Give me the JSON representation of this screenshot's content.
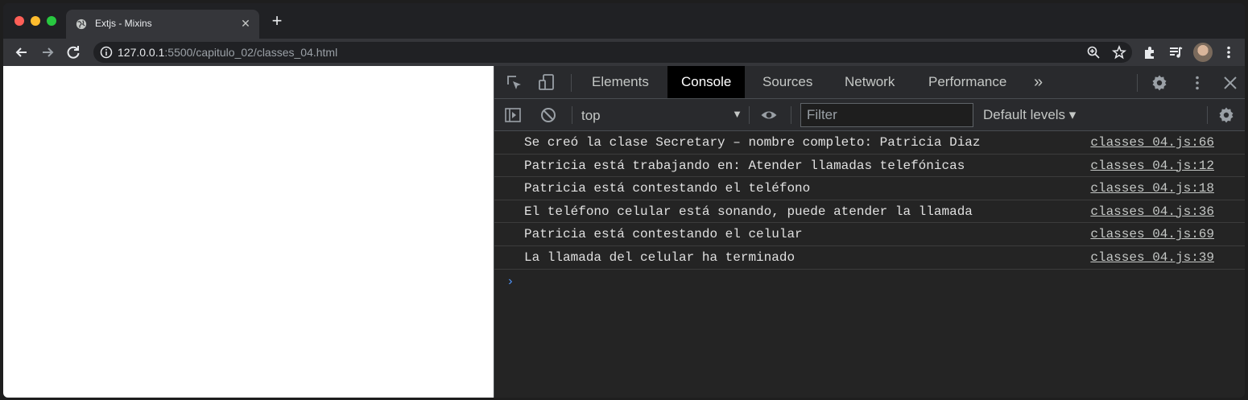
{
  "browser": {
    "tab": {
      "title": "Extjs - Mixins",
      "icon": "globe-icon"
    },
    "url": {
      "host": "127.0.0.1",
      "rest": ":5500/capitulo_02/classes_04.html"
    }
  },
  "devtools": {
    "tabs": [
      {
        "label": "Elements",
        "active": false
      },
      {
        "label": "Console",
        "active": true
      },
      {
        "label": "Sources",
        "active": false
      },
      {
        "label": "Network",
        "active": false
      },
      {
        "label": "Performance",
        "active": false
      }
    ],
    "more_tabs": "»",
    "console": {
      "context": "top",
      "filter_placeholder": "Filter",
      "levels": "Default levels ▾",
      "messages": [
        {
          "text": "Se creó la clase Secretary – nombre completo: Patricia Diaz",
          "source": "classes_04.js:66"
        },
        {
          "text": "Patricia está trabajando en: Atender llamadas telefónicas",
          "source": "classes_04.js:12"
        },
        {
          "text": "Patricia está contestando el teléfono",
          "source": "classes_04.js:18"
        },
        {
          "text": "El teléfono celular está sonando, puede atender la llamada",
          "source": "classes_04.js:36"
        },
        {
          "text": "Patricia está contestando el celular",
          "source": "classes_04.js:69"
        },
        {
          "text": "La llamada del celular ha terminado",
          "source": "classes_04.js:39"
        }
      ],
      "prompt": "›"
    }
  },
  "colors": {
    "accent": "#4d8ff2",
    "active_tab_bg": "#000000",
    "page_bg": "#ffffff"
  }
}
